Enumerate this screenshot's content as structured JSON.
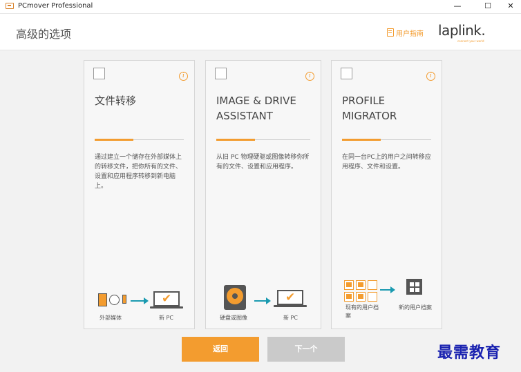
{
  "window": {
    "title": "PCmover Professional",
    "minimize": "—",
    "maximize": "☐",
    "close": "✕"
  },
  "header": {
    "title": "高级的选项",
    "guide_label": "用户指南",
    "logo_text": "laplink.",
    "logo_tagline": "connect your world"
  },
  "cards": [
    {
      "title": "文件转移",
      "description": "通过建立一个储存在外部媒体上的转移文件，把你所有的文件、设置和应用程序转移到新电脑上。",
      "source_label": "外部媒体",
      "target_label": "新 PC"
    },
    {
      "title": "IMAGE & DRIVE ASSISTANT",
      "description": "从旧 PC 物理硬驱或图像转移你所有的文件、设置和应用程序。",
      "source_label": "硬盘或图像",
      "target_label": "新 PC"
    },
    {
      "title": "PROFILE MIGRATOR",
      "description": "在同一台PC上的用户之间转移应用程序、文件和设置。",
      "source_label": "现有的用户档案",
      "target_label": "新的用户档案"
    }
  ],
  "buttons": {
    "back": "返回",
    "next": "下一个"
  },
  "watermark": "最需教育",
  "colors": {
    "accent": "#f39c2f",
    "arrow": "#1a9ab0",
    "disabled": "#cacaca"
  },
  "icons": [
    "app-icon",
    "guide-book-icon",
    "info-icon",
    "external-media-icon",
    "laptop-check-icon",
    "hard-drive-icon",
    "user-profile-grid-icon",
    "windows-logo-icon",
    "arrow-right-icon"
  ]
}
